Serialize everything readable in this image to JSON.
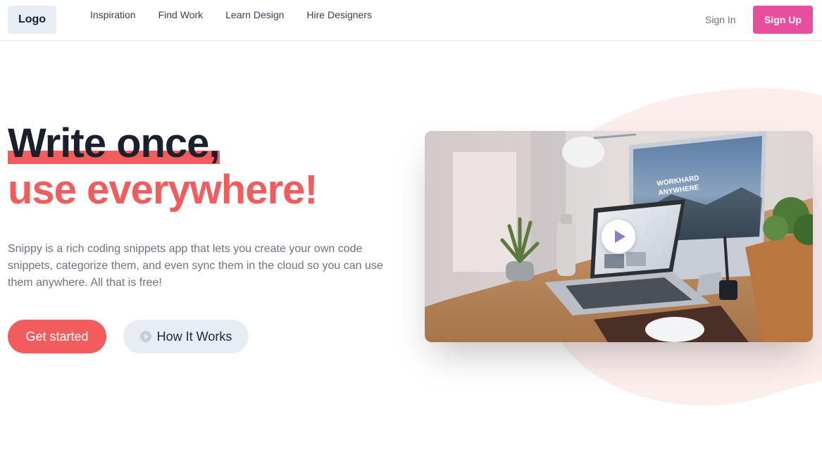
{
  "nav": {
    "logo": "Logo",
    "links": [
      "Inspiration",
      "Find Work",
      "Learn Design",
      "Hire Designers"
    ],
    "signin": "Sign In",
    "signup": "Sign Up"
  },
  "hero": {
    "headline_line1": "Write once,",
    "headline_line2": "use everywhere!",
    "description": "Snippy is a rich coding snippets app that lets you create your own code snippets, categorize them, and even sync them in the cloud so you can use them anywhere. All that is free!",
    "cta_primary": "Get started",
    "cta_secondary": "How It Works"
  },
  "video": {
    "monitor_text_1": "WORKHARD",
    "monitor_text_2": "ANYWHERE"
  },
  "colors": {
    "accent": "#f25c5c",
    "signup": "#e94e9e",
    "blob": "#fdeeee"
  }
}
